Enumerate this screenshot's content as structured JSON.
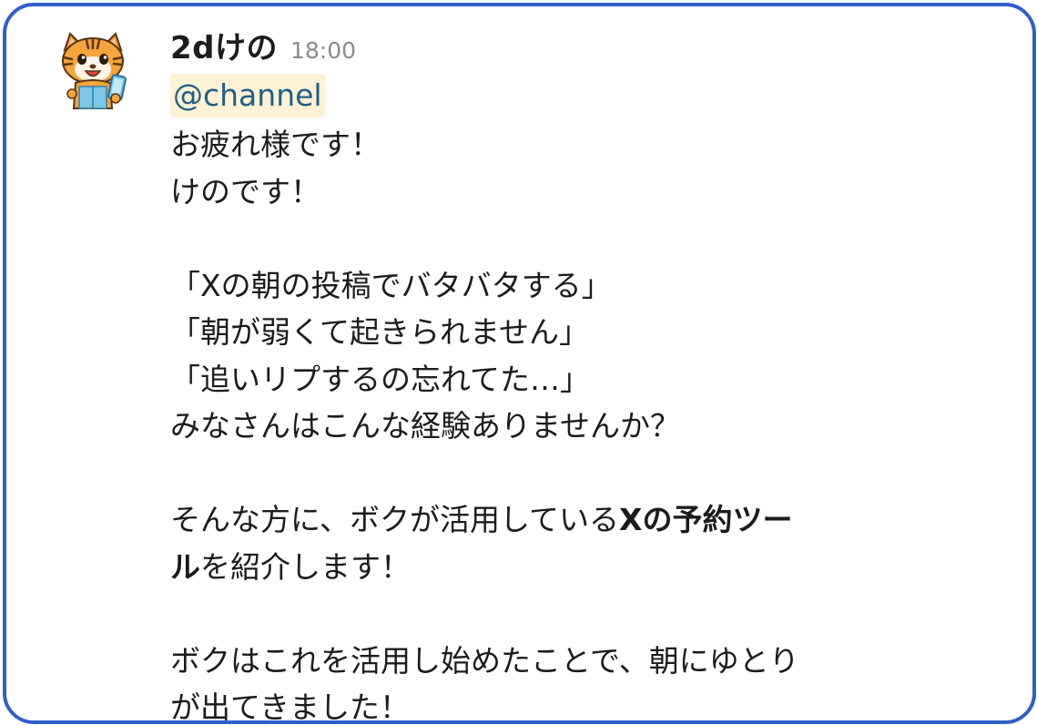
{
  "message": {
    "username": "2dけの",
    "timestamp": "18:00",
    "mention": "@channel",
    "lines": [
      "お疲れ様です！",
      "けのです！",
      "",
      "「Xの朝の投稿でバタバタする」",
      "「朝が弱くて起きられません」",
      "「追いリプするの忘れてた…」",
      "みなさんはこんな経験ありませんか？",
      "",
      "そんな方に、ボクが活用している",
      "Xの予約ツー",
      "ル",
      "を紹介します！",
      "",
      "ボクはこれを活用し始めたことで、朝にゆとり",
      "が出てきました！"
    ]
  },
  "colors": {
    "border": "#2f5fc8",
    "mention_bg": "#fdf2d3",
    "mention_text": "#1f5f8b",
    "timestamp": "#8b8b8b",
    "text": "#1d1c1d"
  },
  "avatar": {
    "icon": "tiger-mascot-icon"
  }
}
